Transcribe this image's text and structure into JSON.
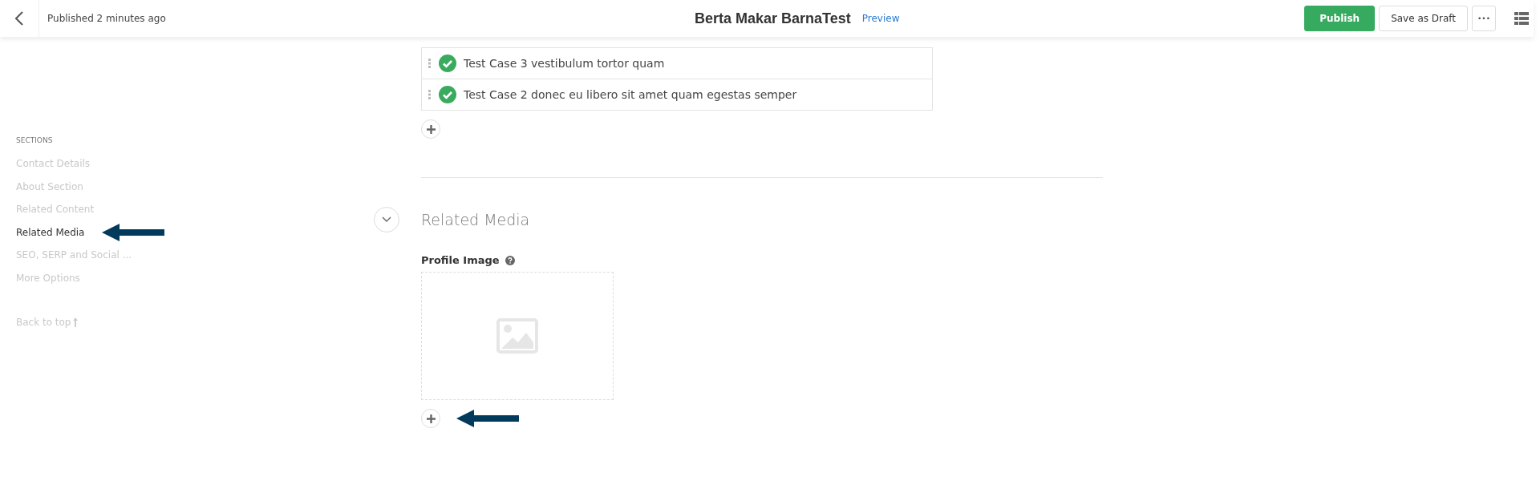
{
  "header": {
    "status": "Published 2 minutes ago",
    "title": "Berta Makar BarnaTest",
    "preview_link": "Preview",
    "buttons": [
      {
        "label": "Publish",
        "kind": "primary"
      },
      {
        "label": "Save as Draft",
        "kind": "secondary"
      },
      {
        "label": "•••",
        "kind": "more"
      }
    ]
  },
  "sidebar": {
    "heading": "SECTIONS",
    "items": [
      {
        "label": "Contact Details",
        "selected": false
      },
      {
        "label": "About Section",
        "selected": false
      },
      {
        "label": "Related Content",
        "selected": false
      },
      {
        "label": "Related Media",
        "selected": true
      },
      {
        "label": "SEO, SERP and Social ...",
        "selected": false
      },
      {
        "label": "More Options",
        "selected": false
      }
    ],
    "back_to_top": "Back to top"
  },
  "related_cases": {
    "items": [
      {
        "title": "Test Case 3 vestibulum tortor quam",
        "checked": true
      },
      {
        "title": "Test Case 2 donec eu libero sit amet quam egestas semper",
        "checked": true
      }
    ]
  },
  "related_media": {
    "heading": "Related Media",
    "expanded": true,
    "field_label": "Profile Image"
  }
}
